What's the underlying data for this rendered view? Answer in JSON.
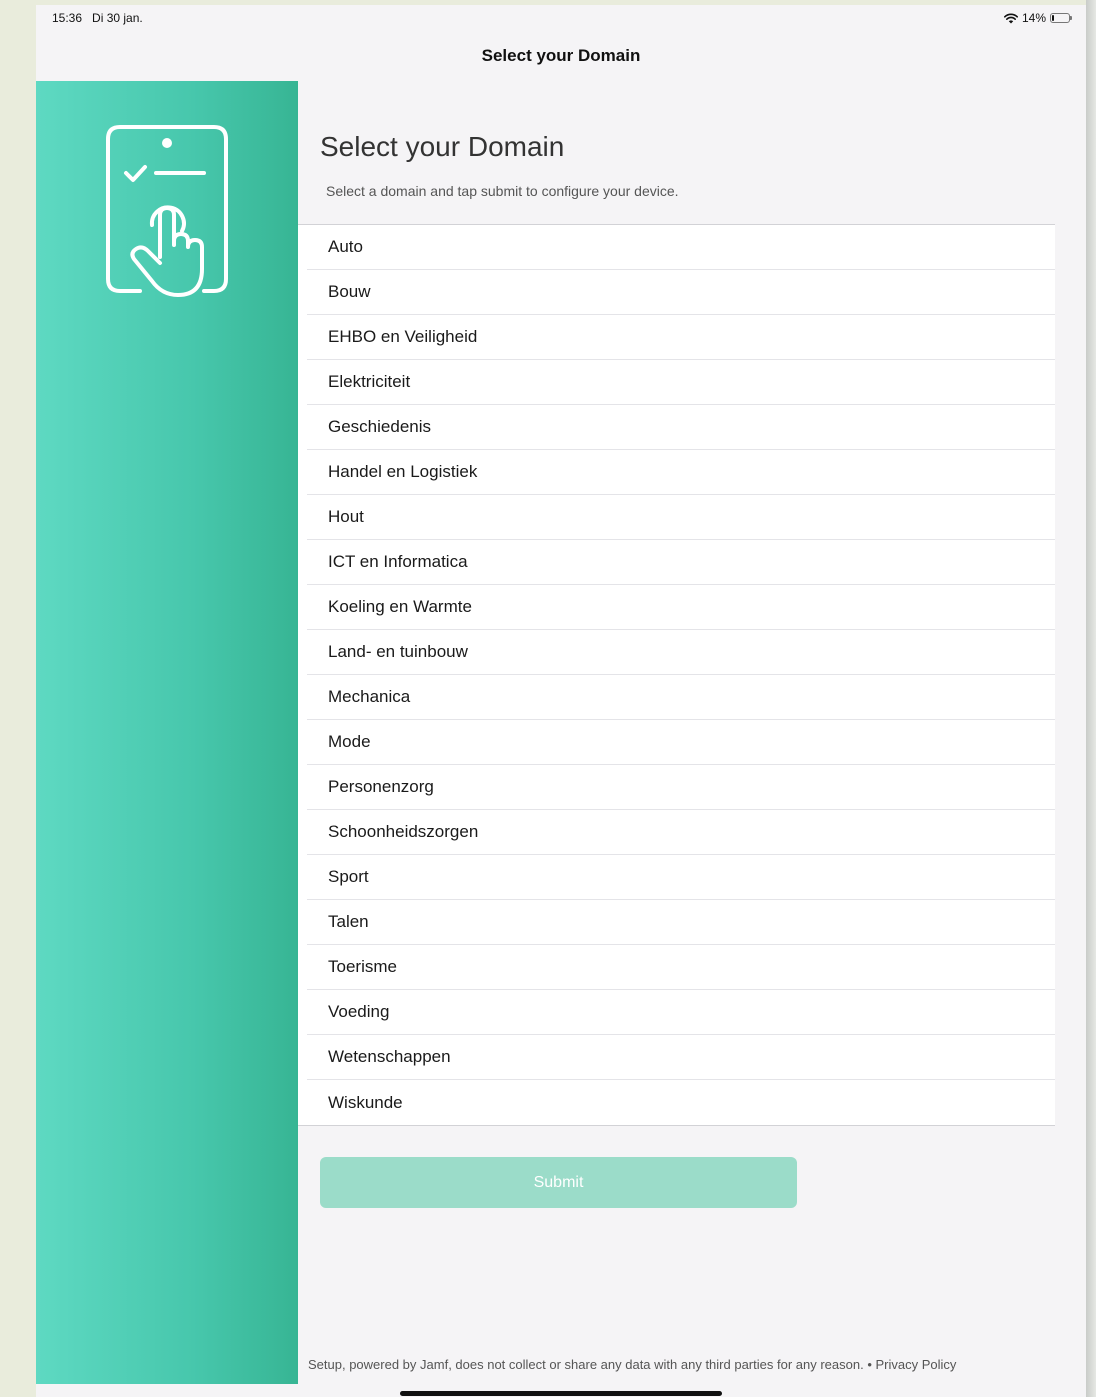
{
  "status_bar": {
    "time": "15:36",
    "date": "Di 30 jan.",
    "battery_percent": "14%",
    "battery_level": 0.14
  },
  "nav": {
    "title": "Select your Domain"
  },
  "sidebar": {
    "icon": "tap-checklist-icon",
    "accent_color": "#47c7ac"
  },
  "main": {
    "heading": "Select your Domain",
    "subtitle": "Select a domain and tap submit to configure your device.",
    "domains": [
      "Auto",
      "Bouw",
      "EHBO en Veiligheid",
      "Elektriciteit",
      "Geschiedenis",
      "Handel en Logistiek",
      "Hout",
      "ICT en Informatica",
      "Koeling en Warmte",
      "Land- en tuinbouw",
      "Mechanica",
      "Mode",
      "Personenzorg",
      "Schoonheidszorgen",
      "Sport",
      "Talen",
      "Toerisme",
      "Voeding",
      "Wetenschappen",
      "Wiskunde"
    ],
    "submit_label": "Submit",
    "submit_color": "#9bdcc9"
  },
  "footer": {
    "text": "Setup, powered by Jamf, does not collect or share any data with any third parties for any reason.",
    "separator": "•",
    "privacy_link": "Privacy Policy"
  }
}
